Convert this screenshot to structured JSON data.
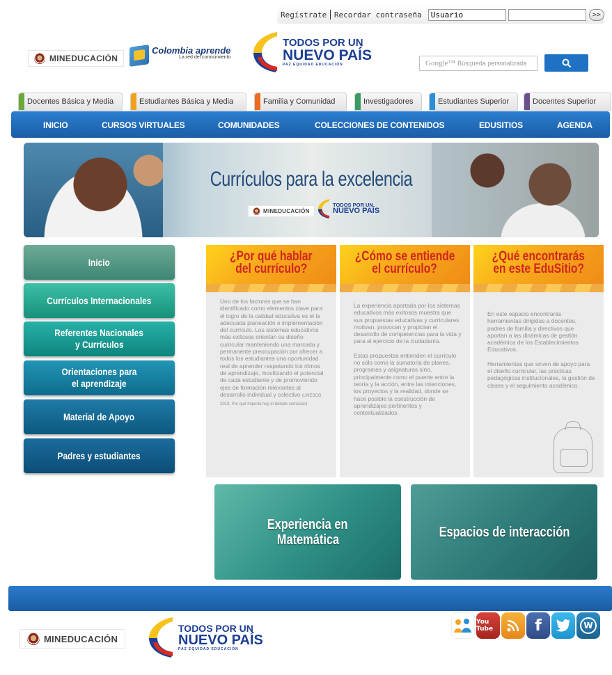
{
  "topbar": {
    "register_label": "Regístrate",
    "recover_label": "Recordar contraseña",
    "username_value": "Usuario",
    "password_value": "",
    "submit_label": ">>"
  },
  "header": {
    "mineducacion_label": "MINEDUCACIÓN",
    "colombia_aprende_title": "Colombia aprende",
    "colombia_aprende_subtitle": "La red del conocimiento",
    "tpun_line1": "TODOS POR UN",
    "tpun_line2": "NUEVO PAÍS",
    "tpun_line3": "PAZ  EQUIDAD  EDUCACIÓN",
    "search_brand": "Google™",
    "search_placeholder": "Búsqueda personalizada",
    "search_button_icon": "search-icon"
  },
  "audience_tabs": [
    {
      "label": "Docentes Básica y Media",
      "color": "#6aa83a"
    },
    {
      "label": "Estudiantes Básica y Media",
      "color": "#f2a21a"
    },
    {
      "label": "Familia y Comunidad",
      "color": "#ee6a1c"
    },
    {
      "label": "Investigadores",
      "color": "#3a9a64"
    },
    {
      "label": "Estudiantes Superior",
      "color": "#2a8fd8"
    },
    {
      "label": "Docentes Superior",
      "color": "#6b4f8c"
    }
  ],
  "main_nav": [
    {
      "label": "INICIO"
    },
    {
      "label": "CURSOS VIRTUALES"
    },
    {
      "label": "COMUNIDADES"
    },
    {
      "label": "COLECCIONES DE CONTENIDOS"
    },
    {
      "label": "EDUSITIOS"
    },
    {
      "label": "AGENDA"
    }
  ],
  "banner": {
    "title": "Currículos para la excelencia",
    "mineducacion_label": "MINEDUCACIÓN",
    "tpun_line1": "TODOS POR UN",
    "tpun_line2": "NUEVO PAÍS"
  },
  "left_menu": [
    {
      "line1": "Inicio",
      "line2": ""
    },
    {
      "line1": "Currículos Internacionales",
      "line2": ""
    },
    {
      "line1": "Referentes Nacionales",
      "line2": "y Currículos"
    },
    {
      "line1": "Orientaciones para",
      "line2": "el aprendizaje"
    },
    {
      "line1": "Material de Apoyo",
      "line2": ""
    },
    {
      "line1": "Padres y estudiantes",
      "line2": ""
    }
  ],
  "columns": [
    {
      "title_line1": "¿Por qué hablar",
      "title_line2": "del currículo?",
      "paragraphs": [
        "Uno de los factores que se han identificado como elementos clave para el logro de la calidad educativa es el la adecuada planeación e implementación del currículo. Los sistemas educativos más exitosos orientan su diseño curricular manteniendo una marcada y permanente preocupación por ofrecer a todos los estudiantes una oportunidad real de aprender respetando los ritmos de aprendizaje, movilizando el potencial de cada estudiante y de promoviendo ejes de formación relevantes al desarrollo individual y colectivo"
      ],
      "citation": "(UNESCO, 2013, Por qué importa hoy el debate curricular)."
    },
    {
      "title_line1": "¿Cómo se entiende",
      "title_line2": "el currículo?",
      "paragraphs": [
        "La experiencia aportada por los sistemas educativos más exitosos muestra que sus propuestas educativas y curriculares motivan, provocan y propician el desarrollo de competencias para la vida y para el ejercicio de la ciudadanía.",
        "Estas propuestas entienden el currículo no sólo como la sumatoria de planes, programas y asignaturas sino, principalmente como el puente entre la teoría y la acción, entre las intenciones, los proyectos y la realidad, donde se hace posible la construcción de aprendizajes pertinentes y contextualizados."
      ],
      "citation": ""
    },
    {
      "title_line1": "¿Qué encontrarás",
      "title_line2": "en este EduSitio?",
      "paragraphs": [
        "En este espacio encontrarás herramientas dirigidas a docentes, padres de familia y directivos que aportan a las dinámicas de gestión académica de los Establecimientos Educativos.",
        "Herramientas que sirven de apoyo para el diseño curricular, las prácticas pedagógicas institucionales, la gestión de clases y el seguimiento académico."
      ],
      "citation": ""
    }
  ],
  "features": [
    {
      "line1": "Experiencia en",
      "line2": "Matemática"
    },
    {
      "line1": "Espacios de interacción",
      "line2": ""
    }
  ],
  "footer": {
    "mineducacion_label": "MINEDUCACIÓN",
    "tpun_line1": "TODOS POR UN",
    "tpun_line2": "NUEVO PAÍS",
    "tpun_line3": "PAZ  EQUIDAD  EDUCACIÓN",
    "social": [
      {
        "icon": "community-icon",
        "color": "#f5a623"
      },
      {
        "icon": "youtube-icon",
        "label": "You Tube",
        "color": "#c4302b"
      },
      {
        "icon": "rss-icon",
        "color": "#f39a1c"
      },
      {
        "icon": "facebook-icon",
        "label": "f",
        "color": "#3b5b99"
      },
      {
        "icon": "twitter-icon",
        "color": "#2aa8e0"
      },
      {
        "icon": "wordpress-icon",
        "label": "W",
        "color": "#21759b"
      }
    ]
  }
}
